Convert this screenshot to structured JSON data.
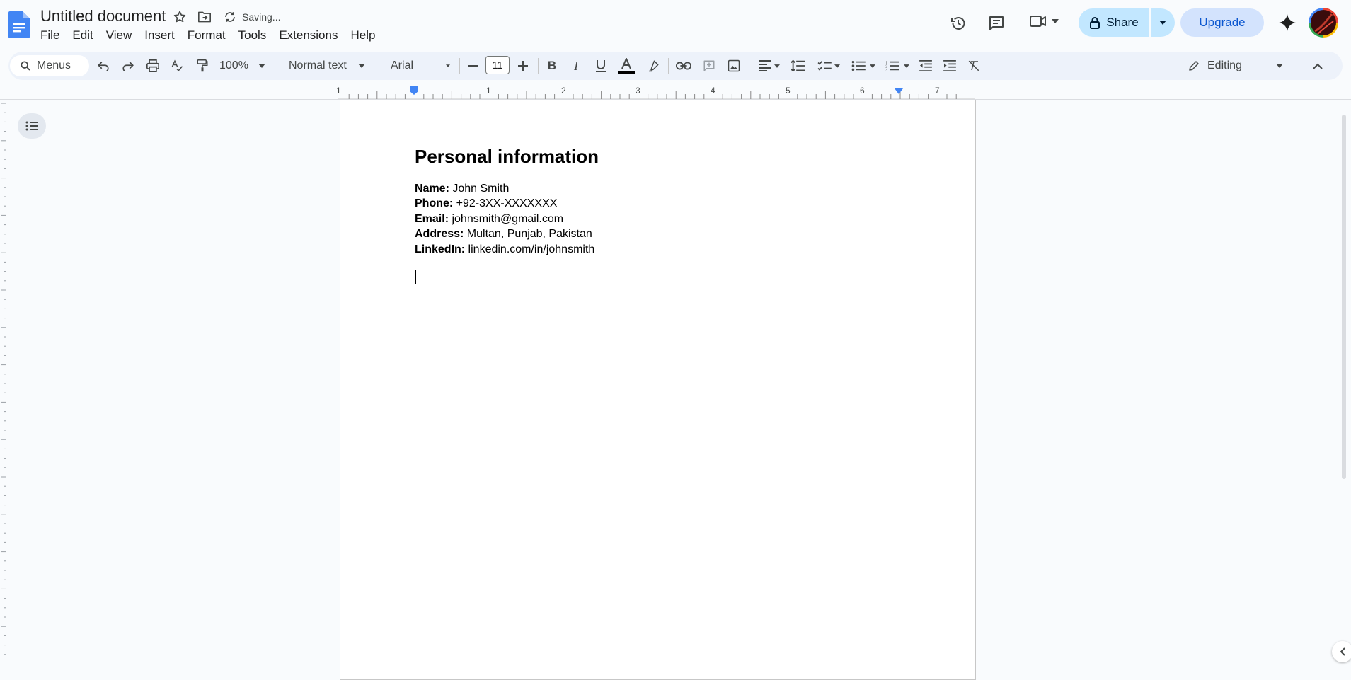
{
  "app": {
    "doc_title": "Untitled document",
    "saving_status": "Saving..."
  },
  "menu": [
    "File",
    "Edit",
    "View",
    "Insert",
    "Format",
    "Tools",
    "Extensions",
    "Help"
  ],
  "header": {
    "share_label": "Share",
    "upgrade_label": "Upgrade"
  },
  "toolbar": {
    "search_label": "Menus",
    "zoom": "100%",
    "style": "Normal text",
    "font": "Arial",
    "font_size": "11",
    "mode": "Editing"
  },
  "ruler": {
    "marks": [
      "1",
      "1",
      "2",
      "3",
      "4",
      "5",
      "6",
      "7"
    ]
  },
  "document": {
    "heading": "Personal information",
    "fields": [
      {
        "label": "Name:",
        "value": " John Smith"
      },
      {
        "label": "Phone:",
        "value": " +92-3XX-XXXXXXX"
      },
      {
        "label": "Email:",
        "value": " johnsmith@gmail.com"
      },
      {
        "label": "Address:",
        "value": " Multan, Punjab, Pakistan"
      },
      {
        "label": "LinkedIn:",
        "value": " linkedin.com/in/johnsmith"
      }
    ]
  },
  "colors": {
    "accent": "#0b57d0",
    "share_bg": "#c2e7ff",
    "toolbar_bg": "#edf2fa",
    "text_color_underline": "#000000"
  },
  "icons": [
    "docs-logo-icon",
    "star-icon",
    "move-folder-icon",
    "sync-icon",
    "history-icon",
    "comment-icon",
    "meet-icon",
    "lock-icon",
    "gemini-icon",
    "search-icon",
    "undo-icon",
    "redo-icon",
    "print-icon",
    "spellcheck-icon",
    "paint-format-icon",
    "bold-icon",
    "italic-icon",
    "underline-icon",
    "text-color-icon",
    "highlight-icon",
    "link-icon",
    "add-comment-icon",
    "image-icon",
    "align-icon",
    "line-spacing-icon",
    "checklist-icon",
    "bullet-list-icon",
    "numbered-list-icon",
    "decrease-indent-icon",
    "increase-indent-icon",
    "clear-format-icon",
    "pencil-icon",
    "collapse-icon",
    "outline-icon"
  ]
}
